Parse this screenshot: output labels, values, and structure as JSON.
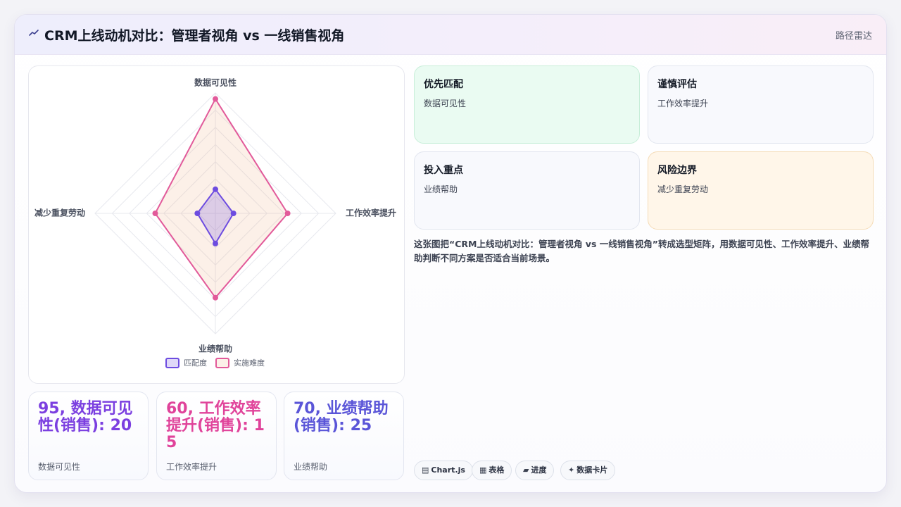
{
  "header": {
    "title": "CRM上线动机对比：管理者视角 vs 一线销售视角",
    "right_label": "路径雷达"
  },
  "colors": {
    "match": "#6d4ce0",
    "difficulty": "#e25a9a",
    "accent_purple": "#7b3fe0",
    "accent_pink": "#e0439a",
    "accent_indigo": "#5a55d8"
  },
  "chart_data": {
    "type": "radar",
    "axes": [
      "数据可见性",
      "工作效率提升",
      "业绩帮助",
      "减少重复劳动"
    ],
    "rmax": 100,
    "rings": 7,
    "series": [
      {
        "name": "匹配度",
        "values": [
          20,
          15,
          25,
          15
        ]
      },
      {
        "name": "实施难度",
        "values": [
          95,
          60,
          70,
          50
        ]
      }
    ],
    "legend_position": "bottom"
  },
  "stats": [
    {
      "value": "95, 数据可见性(销售): 20",
      "label": "数据可见性"
    },
    {
      "value": "60, 工作效率提升(销售): 15",
      "label": "工作效率提升"
    },
    {
      "value": "70, 业绩帮助(销售): 25",
      "label": "业绩帮助"
    }
  ],
  "quadrants": [
    {
      "title": "优先匹配",
      "sub": "数据可见性"
    },
    {
      "title": "谨慎评估",
      "sub": "工作效率提升"
    },
    {
      "title": "投入重点",
      "sub": "业绩帮助"
    },
    {
      "title": "风险边界",
      "sub": "减少重复劳动"
    }
  ],
  "description": "这张图把“CRM上线动机对比：管理者视角 vs 一线销售视角”转成选型矩阵，用数据可见性、工作效率提升、业绩帮助判断不同方案是否适合当前场景。",
  "tags": [
    {
      "icon": "▤",
      "label": "Chart.js"
    },
    {
      "icon": "▦",
      "label": "表格"
    },
    {
      "icon": "▰",
      "label": "进度"
    },
    {
      "icon": "✦",
      "label": "数据卡片"
    }
  ]
}
